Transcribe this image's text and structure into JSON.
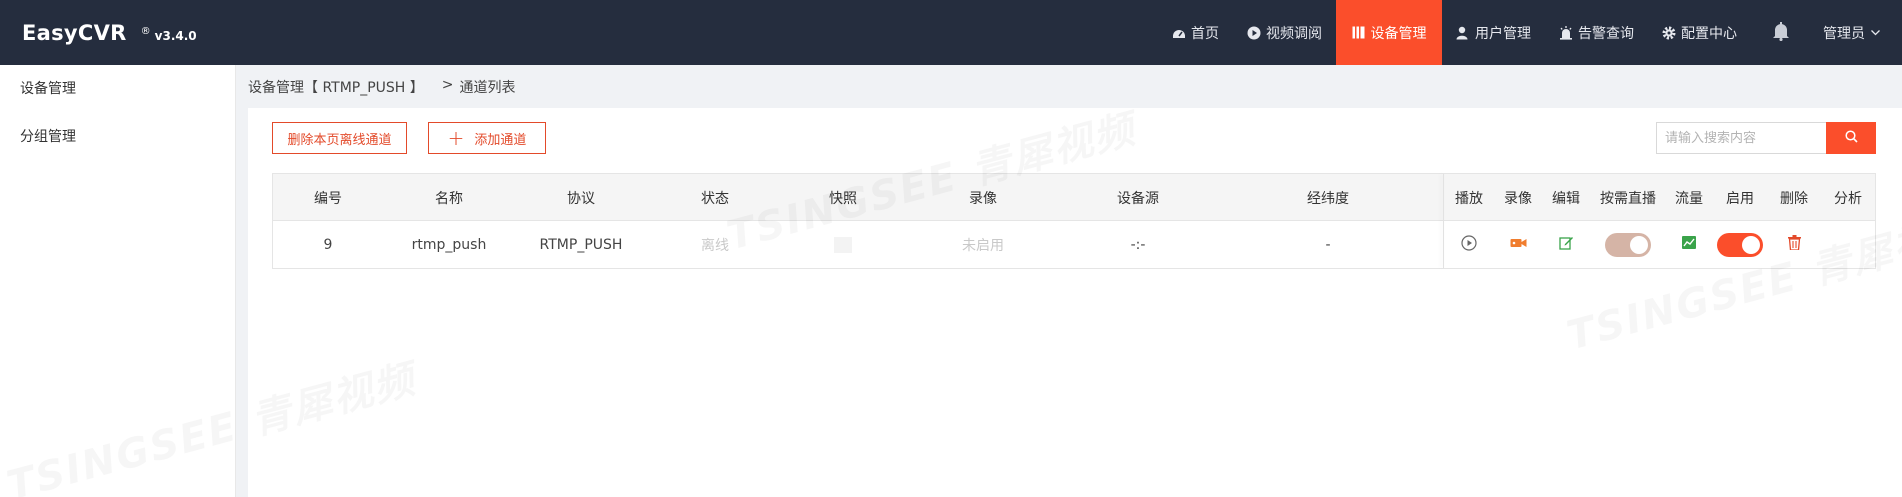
{
  "brand": {
    "name": "EasyCVR",
    "reg": "®",
    "version": "v3.4.0"
  },
  "nav": [
    {
      "label": "首页",
      "icon": "dashboard-icon"
    },
    {
      "label": "视频调阅",
      "icon": "play-circle-icon"
    },
    {
      "label": "设备管理",
      "icon": "device-icon",
      "active": true
    },
    {
      "label": "用户管理",
      "icon": "user-icon"
    },
    {
      "label": "告警查询",
      "icon": "alarm-icon"
    },
    {
      "label": "配置中心",
      "icon": "gear-icon"
    }
  ],
  "user": {
    "label": "管理员"
  },
  "sidebar": {
    "items": [
      {
        "label": "设备管理"
      },
      {
        "label": "分组管理"
      }
    ]
  },
  "breadcrumb": {
    "device": "设备管理【 RTMP_PUSH 】",
    "sep": ">",
    "current": "通道列表"
  },
  "toolbar": {
    "delete_label": "删除本页离线通道",
    "add_label": "添加通道"
  },
  "search": {
    "placeholder": "请输入搜索内容"
  },
  "table": {
    "columns": [
      "编号",
      "名称",
      "协议",
      "状态",
      "快照",
      "录像",
      "设备源",
      "经纬度",
      "播放",
      "录像",
      "编辑",
      "按需直播",
      "流量",
      "启用",
      "删除",
      "分析"
    ],
    "rows": [
      {
        "id": "9",
        "name": "rtmp_push",
        "protocol": "RTMP_PUSH",
        "status": "离线",
        "snapshot": "",
        "record": "未启用",
        "source": "-:-",
        "latlng": "-",
        "on_demand": false,
        "enabled": true
      }
    ]
  },
  "colors": {
    "accent": "#fb4e2b",
    "topbar": "#252d3e",
    "success": "#3aa34a",
    "warning": "#f07d2e"
  },
  "watermark": "TSINGSEE 青犀视频"
}
